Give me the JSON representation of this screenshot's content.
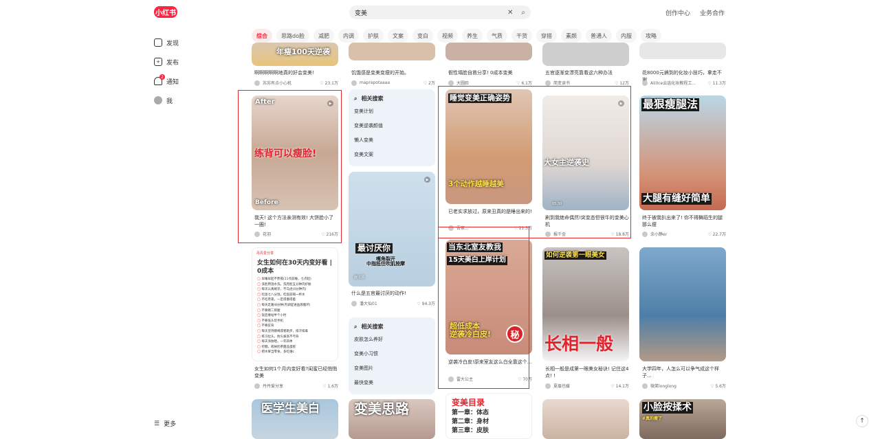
{
  "app": {
    "logo": "小红书"
  },
  "search": {
    "query": "变美"
  },
  "topbar": {
    "creator": "创作中心",
    "business": "业务合作"
  },
  "sidebar": {
    "discover": "发现",
    "publish": "发布",
    "notify": "通知",
    "notify_badge": "2",
    "me": "我",
    "more": "更多"
  },
  "tabs": [
    "综合",
    "思路do脸",
    "减肥",
    "内调",
    "护肤",
    "文案",
    "变白",
    "视频",
    "养生",
    "气质",
    "干货",
    "穿搭",
    "素颜",
    "普通人",
    "内服",
    "攻略"
  ],
  "row0": [
    {
      "overlay": "年瘦100天逆袭",
      "cap": "啊啊啊啊啊地真的好会变美!",
      "user": "苏苏有点小心机",
      "likes": "23.1万"
    },
    {
      "cap": "饥饿感是变美变瘦的开始。",
      "user": "maprapotaaaa",
      "likes": "2万"
    },
    {
      "cap": "假性塌脸自救分享! 0成本变美",
      "user": "大圆脸",
      "likes": "6.1万"
    },
    {
      "cap": "五官逐渐变漂亮靠看这六种办法",
      "user": "简变读书",
      "likes": "12万"
    },
    {
      "cap": "花8000元搞到的化妆小技巧，拿走不谢",
      "user": "Ali0ce云选化妆教程工...",
      "likes": "11.3万"
    }
  ],
  "col1": [
    {
      "top": "After",
      "bottom": "Before",
      "overlay": "练背可以瘦脸!",
      "cap": "我天! 这个方法亲测有效! 大饼脸小了一圈!",
      "user": "花羽",
      "likes": "216万"
    },
    {
      "heading": "女生如何在30天内变好看 | 0成本",
      "list": [
        "早睡早起不熬夜(11点前睡，七点起)",
        "洗脸用温水洗，洗完脸五分钟内护肤",
        "每天认真刷牙，不马虎(4分钟内)",
        "吃饭七八分饱，吃饭前喝一杯水",
        "不吃宵夜，一定得饿得着",
        "每天走路/8分钟(内调促进血液循环)",
        "不要瞎二郎腿",
        "饭后要站半个小时",
        "不要低头玩手机",
        "不要驼背",
        "每天坚持跳绳或者跑步，排汗排毒",
        "练习拉头，抬头拔高不弓背",
        "每天涂防晒，一年四季",
        "控糖，戒掉奶茶甜品蛋糕",
        "把水果当零食，多吃维c"
      ],
      "tag": "丹丹爱分享",
      "cap": "女生如何1个月内变好看?闺蜜已经悄悄变美",
      "user": "丹丹爱分享",
      "likes": "1.6万"
    },
    {
      "overlay": "医学生美白"
    }
  ],
  "col2": [
    {
      "heading": "相关搜索",
      "items": [
        "变美计划",
        "变美逆袭颜值",
        "懒人变美",
        "变美文案"
      ]
    },
    {
      "overlay1": "最讨厌你",
      "overlay2": "嘴角裂开\n中指抵住吹肌按摩",
      "tag": "鹿江源",
      "cap": "什么是五官最讨厌的动作!",
      "user": "潘大仙01",
      "likes": "94.3万"
    },
    {
      "heading": "相关搜索",
      "items": [
        "皮肤怎么养好",
        "变美小习惯",
        "变美图片",
        "最快变美"
      ]
    },
    {
      "overlay": "变美思路"
    }
  ],
  "col3": [
    {
      "overlay1": "睡觉变美正确姿势",
      "overlay2": "3个动作越睡越美",
      "cap": "已老实求放过，原来丑真的是睡出来的!",
      "user": "吾家...",
      "likes": "11.3万"
    },
    {
      "overlay1": "当东北室友教我",
      "overlay2": "15天美白上岸计划",
      "overlay3": "超低成本\n逆袭冷白皮!",
      "stamp": "秘",
      "cap": "逆袭冷白皮!原来室友这么白全靠这个...",
      "user": "雷大公主",
      "likes": "70万"
    },
    {
      "title": "变美目录",
      "lines": [
        "第一章：体态",
        "第二章：身材",
        "第三章：皮肤"
      ]
    }
  ],
  "col4": [
    {
      "overlay": "大女主逆袭史",
      "tag": "05:30",
      "cap": "刷到我绝命偶然!突变态但很牛的变美心机",
      "user": "报千金",
      "likes": "18.8万"
    },
    {
      "overlay1": "如何逆袭第一眼美女",
      "overlay2": "长相一般",
      "cap": "长相一般是成第一眼美女秘诀! 记住这4点! !",
      "user": "夏眉也媛",
      "likes": "14.1万"
    },
    {}
  ],
  "col5": [
    {
      "overlay1": "最狠瘦腿法",
      "overlay2": "大腿有缝好简单",
      "cap": "终于被我扒出来了! 你不得舞蹈生的腿那么瘦",
      "user": "余小静er",
      "likes": "22.7万"
    },
    {
      "cap": "大学四年，人怎么可以争气成这个样子...",
      "user": "微笑longlong",
      "likes": "5.6万"
    },
    {
      "overlay": "小脸按揉术",
      "tag": "#真的瘦了"
    }
  ]
}
